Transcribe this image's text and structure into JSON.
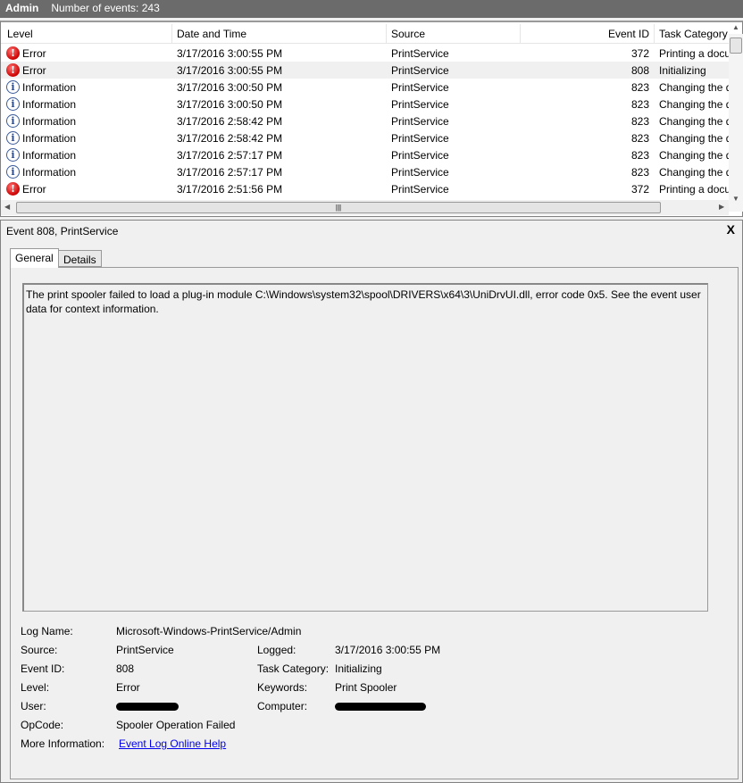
{
  "title": {
    "log": "Admin",
    "count": "Number of events: 243"
  },
  "columns": {
    "level": "Level",
    "date": "Date and Time",
    "source": "Source",
    "event_id": "Event ID",
    "task": "Task Category"
  },
  "rows": [
    {
      "level": "Error",
      "type": "error",
      "date": "3/17/2016 3:00:55 PM",
      "source": "PrintService",
      "id": "372",
      "task": "Printing a docu"
    },
    {
      "level": "Error",
      "type": "error",
      "date": "3/17/2016 3:00:55 PM",
      "source": "PrintService",
      "id": "808",
      "task": "Initializing"
    },
    {
      "level": "Information",
      "type": "info",
      "date": "3/17/2016 3:00:50 PM",
      "source": "PrintService",
      "id": "823",
      "task": "Changing the d"
    },
    {
      "level": "Information",
      "type": "info",
      "date": "3/17/2016 3:00:50 PM",
      "source": "PrintService",
      "id": "823",
      "task": "Changing the d"
    },
    {
      "level": "Information",
      "type": "info",
      "date": "3/17/2016 2:58:42 PM",
      "source": "PrintService",
      "id": "823",
      "task": "Changing the d"
    },
    {
      "level": "Information",
      "type": "info",
      "date": "3/17/2016 2:58:42 PM",
      "source": "PrintService",
      "id": "823",
      "task": "Changing the d"
    },
    {
      "level": "Information",
      "type": "info",
      "date": "3/17/2016 2:57:17 PM",
      "source": "PrintService",
      "id": "823",
      "task": "Changing the d"
    },
    {
      "level": "Information",
      "type": "info",
      "date": "3/17/2016 2:57:17 PM",
      "source": "PrintService",
      "id": "823",
      "task": "Changing the d"
    },
    {
      "level": "Error",
      "type": "error",
      "date": "3/17/2016 2:51:56 PM",
      "source": "PrintService",
      "id": "372",
      "task": "Printing a docu"
    }
  ],
  "selected_index": 1,
  "details": {
    "title": "Event 808, PrintService",
    "close": "X",
    "tabs": [
      "General",
      "Details"
    ],
    "message": "The print spooler failed to load a plug-in module C:\\Windows\\system32\\spool\\DRIVERS\\x64\\3\\UniDrvUI.dll, error code 0x5. See the event user data for context information.",
    "labels": {
      "log_name": "Log Name:",
      "source": "Source:",
      "event_id": "Event ID:",
      "level": "Level:",
      "user": "User:",
      "opcode": "OpCode:",
      "more_info": "More Information:",
      "logged": "Logged:",
      "task_category": "Task Category:",
      "keywords": "Keywords:",
      "computer": "Computer:"
    },
    "values": {
      "log_name": "Microsoft-Windows-PrintService/Admin",
      "source": "PrintService",
      "event_id": "808",
      "level": "Error",
      "opcode": "Spooler Operation Failed",
      "more_info": "Event Log Online Help",
      "logged": "3/17/2016 3:00:55 PM",
      "task_category": "Initializing",
      "keywords": "Print Spooler"
    }
  }
}
